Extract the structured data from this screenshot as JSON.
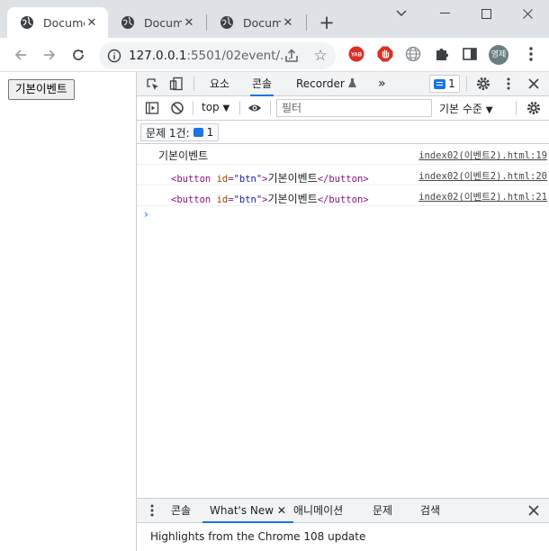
{
  "browser": {
    "tabs": [
      {
        "title": "Docume",
        "active": true
      },
      {
        "title": "Docume",
        "active": false
      },
      {
        "title": "Docume",
        "active": false
      }
    ],
    "url_host": "127.0.0.1",
    "url_path": ":5501/02event/..."
  },
  "extensions": {
    "avatar_label": "영제",
    "yab_label": "YAB"
  },
  "page": {
    "button_label": "기본이벤트"
  },
  "devtools": {
    "tabs": [
      "요소",
      "콘솔",
      "Recorder"
    ],
    "active_tab": "콘솔",
    "more_tabs": "»",
    "issue_count": "1",
    "context": "top",
    "filter_placeholder": "필터",
    "level": "기본 수준",
    "issues_label": "문제 1건:",
    "issues_count": "1",
    "console_messages": [
      {
        "text": "기본이벤트",
        "source": "index02(이벤트2).html:19"
      },
      {
        "tag_open": "<button ",
        "attr": "id",
        "eq": "=",
        "value": "\"btn\"",
        "tag_close": ">",
        "inner": "기본이벤트",
        "end_tag": "</button>",
        "source": "index02(이벤트2).html:20"
      },
      {
        "tag_open": "<button ",
        "attr": "id",
        "eq": "=",
        "value": "\"btn\"",
        "tag_close": ">",
        "inner": "기본이벤트",
        "end_tag": "</button>",
        "source": "index02(이벤트2).html:21"
      }
    ],
    "prompt": "›",
    "drawer": {
      "tabs": [
        "콘솔",
        "What's New",
        "애니메이션",
        "문제",
        "검색"
      ],
      "active_tab": "What's New",
      "body": "Highlights from the Chrome 108 update"
    }
  },
  "colors": {
    "accent": "#1a73e8",
    "tabstrip": "#dee1e6",
    "omnibox": "#f1f3f4"
  }
}
